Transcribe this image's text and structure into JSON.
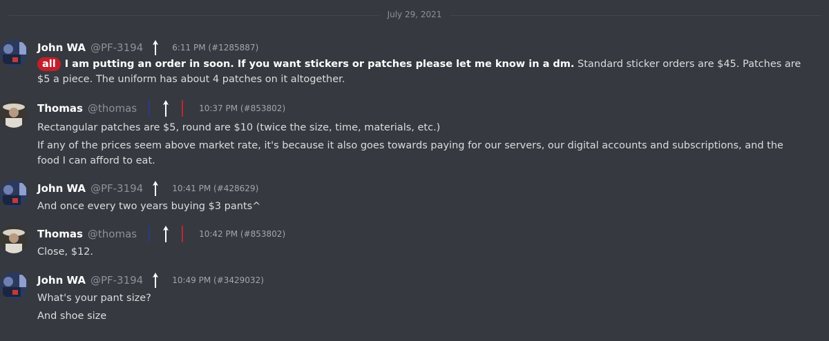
{
  "date_divider": "July 29, 2021",
  "colors": {
    "background": "#36393f",
    "mention_bg": "#c21f2b",
    "badge_white": "#ffffff",
    "badge_blue": "#2a3a8a",
    "badge_red": "#c0282d"
  },
  "messages": [
    {
      "username": "John WA",
      "handle": "@PF-3194",
      "badges": [
        "arrow-up-icon"
      ],
      "timestamp": "6:11 PM (#1285887)",
      "lines": [
        {
          "mention": "all",
          "bold": "I am putting an order in soon. If you want stickers or patches please let me know in a dm.",
          "text": " Standard sticker orders are $45. Patches are $5 a piece. The uniform has about 4 patches on it altogether."
        }
      ]
    },
    {
      "username": "Thomas",
      "handle": "@thomas",
      "badges": [
        "blue-arrow-icon",
        "white-arrow-icon",
        "red-arrow-icon"
      ],
      "timestamp": "10:37 PM (#853802)",
      "lines": [
        {
          "text": "Rectangular patches are $5, round are $10 (twice the size, time, materials, etc.)"
        },
        {
          "text": "If any of the prices seem above market rate, it's because it also goes towards paying for our servers, our digital accounts and subscriptions, and the food I can afford to eat."
        }
      ]
    },
    {
      "username": "John WA",
      "handle": "@PF-3194",
      "badges": [
        "arrow-up-icon"
      ],
      "timestamp": "10:41 PM (#428629)",
      "lines": [
        {
          "text": "And once every two years buying $3 pants^"
        }
      ]
    },
    {
      "username": "Thomas",
      "handle": "@thomas",
      "badges": [
        "blue-arrow-icon",
        "white-arrow-icon",
        "red-arrow-icon"
      ],
      "timestamp": "10:42 PM (#853802)",
      "lines": [
        {
          "text": "Close, $12."
        }
      ]
    },
    {
      "username": "John WA",
      "handle": "@PF-3194",
      "badges": [
        "arrow-up-icon"
      ],
      "timestamp": "10:49 PM (#3429032)",
      "lines": [
        {
          "text": "What's your pant size?"
        },
        {
          "text": "And shoe size"
        }
      ]
    }
  ]
}
